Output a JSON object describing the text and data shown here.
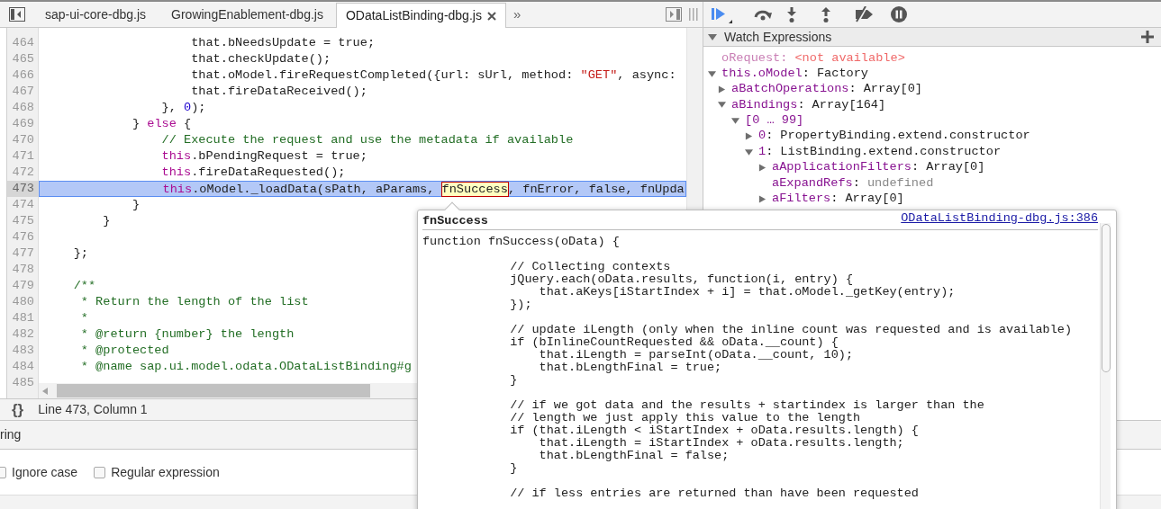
{
  "editor_tabs": [
    {
      "label": "sap-ui-core-dbg.js",
      "selected": false
    },
    {
      "label": "GrowingEnablement-dbg.js",
      "selected": false
    },
    {
      "label": "ODataListBinding-dbg.js",
      "selected": true
    }
  ],
  "tab_overflow": "»",
  "code_lines": [
    {
      "number": "464",
      "current": false,
      "tokens": [
        {
          "kind": "plain",
          "text": "                    that.bNeedsUpdate = true;"
        }
      ]
    },
    {
      "number": "465",
      "current": false,
      "tokens": [
        {
          "kind": "plain",
          "text": "                    that.checkUpdate();"
        }
      ]
    },
    {
      "number": "466",
      "current": false,
      "tokens": [
        {
          "kind": "plain",
          "text": "                    that.oModel.fireRequestCompleted({url: sUrl, method: "
        },
        {
          "kind": "string",
          "text": "\"GET\""
        },
        {
          "kind": "plain",
          "text": ", async:"
        }
      ]
    },
    {
      "number": "467",
      "current": false,
      "tokens": [
        {
          "kind": "plain",
          "text": "                    that.fireDataReceived();"
        }
      ]
    },
    {
      "number": "468",
      "current": false,
      "tokens": [
        {
          "kind": "plain",
          "text": "                }, "
        },
        {
          "kind": "number",
          "text": "0"
        },
        {
          "kind": "plain",
          "text": ");"
        }
      ]
    },
    {
      "number": "469",
      "current": false,
      "tokens": [
        {
          "kind": "plain",
          "text": "            } "
        },
        {
          "kind": "keyword",
          "text": "else"
        },
        {
          "kind": "plain",
          "text": " {"
        }
      ]
    },
    {
      "number": "470",
      "current": false,
      "tokens": [
        {
          "kind": "comment",
          "text": "                // Execute the request and use the metadata if available"
        }
      ]
    },
    {
      "number": "471",
      "current": false,
      "tokens": [
        {
          "kind": "keyword",
          "text": "                this"
        },
        {
          "kind": "plain",
          "text": ".bPendingRequest = true;"
        }
      ]
    },
    {
      "number": "472",
      "current": false,
      "tokens": [
        {
          "kind": "keyword",
          "text": "                this"
        },
        {
          "kind": "plain",
          "text": ".fireDataRequested();"
        }
      ]
    },
    {
      "number": "473",
      "current": true,
      "tokens": [
        {
          "kind": "keyword",
          "text": "                this"
        },
        {
          "kind": "plain",
          "text": ".oModel._loadData(sPath, aParams, "
        },
        {
          "kind": "hover",
          "text": "fnSuccess"
        },
        {
          "kind": "plain",
          "text": ", fnError, false, fnUpda"
        }
      ]
    },
    {
      "number": "474",
      "current": false,
      "tokens": [
        {
          "kind": "plain",
          "text": "            }"
        }
      ]
    },
    {
      "number": "475",
      "current": false,
      "tokens": [
        {
          "kind": "plain",
          "text": "        }"
        }
      ]
    },
    {
      "number": "476",
      "current": false
    },
    {
      "number": "477",
      "current": false,
      "tokens": [
        {
          "kind": "plain",
          "text": "    };"
        }
      ]
    },
    {
      "number": "478",
      "current": false
    },
    {
      "number": "479",
      "current": false,
      "tokens": [
        {
          "kind": "comment",
          "text": "    /**"
        }
      ]
    },
    {
      "number": "480",
      "current": false,
      "tokens": [
        {
          "kind": "comment",
          "text": "     * Return the length of the list"
        }
      ]
    },
    {
      "number": "481",
      "current": false,
      "tokens": [
        {
          "kind": "comment",
          "text": "     *"
        }
      ]
    },
    {
      "number": "482",
      "current": false,
      "tokens": [
        {
          "kind": "comment",
          "text": "     * @return {number} the length"
        }
      ]
    },
    {
      "number": "483",
      "current": false,
      "tokens": [
        {
          "kind": "comment",
          "text": "     * @protected"
        }
      ]
    },
    {
      "number": "484",
      "current": false,
      "tokens": [
        {
          "kind": "comment",
          "text": "     * @name sap.ui.model.odata.ODataListBinding#g"
        }
      ]
    },
    {
      "number": "485",
      "current": false
    }
  ],
  "status_bar": {
    "pretty_print": "{}",
    "position": "Line 473, Column 1"
  },
  "watch": {
    "title": "Watch Expressions",
    "expanded": true,
    "items": [
      {
        "kind": "unavailable",
        "name": "oRequest",
        "separator": ":",
        "value": "<not available>"
      },
      {
        "kind": "node",
        "name": "this.oModel",
        "separator": ":",
        "value": "Factory",
        "expanded": true,
        "children": [
          {
            "kind": "node",
            "name": "aBatchOperations",
            "separator": ":",
            "value": "Array[0]",
            "expanded": false
          },
          {
            "kind": "node",
            "name": "aBindings",
            "separator": ":",
            "value": "Array[164]",
            "expanded": true,
            "children": [
              {
                "kind": "node",
                "name": "[0 … 99]",
                "expanded": true,
                "children": [
                  {
                    "kind": "node",
                    "name": "0",
                    "separator": ":",
                    "value": "PropertyBinding.extend.constructor",
                    "expanded": false
                  },
                  {
                    "kind": "node",
                    "name": "1",
                    "separator": ":",
                    "value": "ListBinding.extend.constructor",
                    "expanded": true,
                    "children": [
                      {
                        "kind": "node",
                        "name": "aApplicationFilters",
                        "separator": ":",
                        "value": "Array[0]",
                        "expanded": false
                      },
                      {
                        "kind": "undefined",
                        "name": "aExpandRefs",
                        "separator": ":",
                        "value": "undefined"
                      },
                      {
                        "kind": "node",
                        "name": "aFilters",
                        "separator": ":",
                        "value": "Array[0]",
                        "expanded": false
                      }
                    ]
                  }
                ]
              }
            ]
          }
        ]
      }
    ]
  },
  "drawer": {
    "tab_label": "ring",
    "options": [
      {
        "label": "Ignore case",
        "checked": false
      },
      {
        "label": "Regular expression",
        "checked": false
      }
    ]
  },
  "popover": {
    "title": "fnSuccess",
    "link": "ODataListBinding-dbg.js:386",
    "source": "function fnSuccess(oData) {\n\n            // Collecting contexts\n            jQuery.each(oData.results, function(i, entry) {\n                that.aKeys[iStartIndex + i] = that.oModel._getKey(entry);\n            });\n\n            // update iLength (only when the inline count was requested and is available)\n            if (bInlineCountRequested && oData.__count) {\n                that.iLength = parseInt(oData.__count, 10);\n                that.bLengthFinal = true;\n            }\n\n            // if we got data and the results + startindex is larger than the\n            // length we just apply this value to the length\n            if (that.iLength < iStartIndex + oData.results.length) {\n                that.iLength = iStartIndex + oData.results.length;\n                that.bLengthFinal = false;\n            }\n\n            // if less entries are returned than have been requested"
  }
}
